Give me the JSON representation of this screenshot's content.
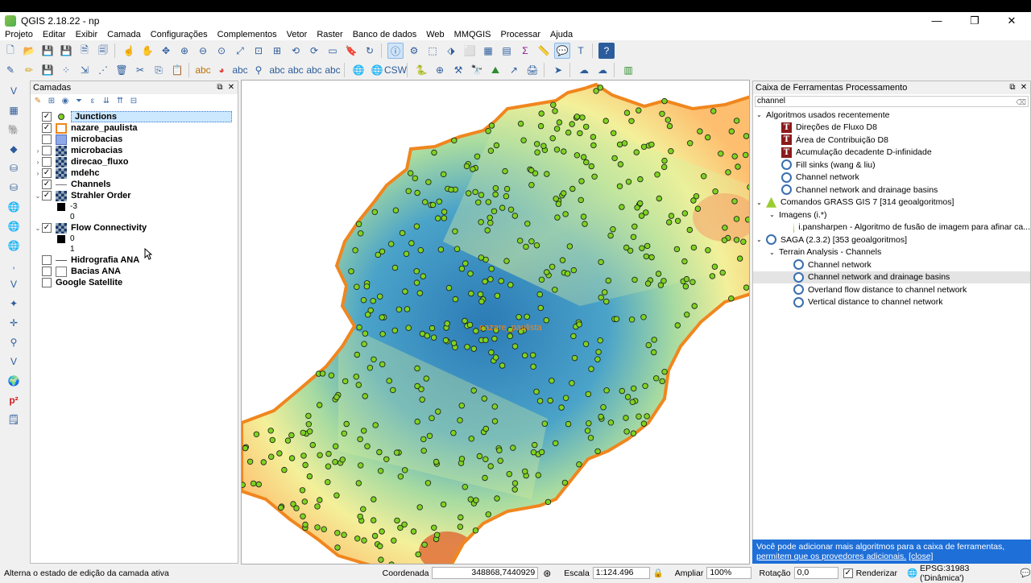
{
  "window": {
    "title": "QGIS 2.18.22 - np",
    "minimize": "—",
    "maximize": "❐",
    "close": "✕"
  },
  "menu": [
    "Projeto",
    "Editar",
    "Exibir",
    "Camada",
    "Configurações",
    "Complementos",
    "Vetor",
    "Raster",
    "Banco de dados",
    "Web",
    "MMQGIS",
    "Processar",
    "Ajuda"
  ],
  "layers_panel": {
    "title": "Camadas",
    "layers": [
      {
        "name": "Junctions",
        "checked": true,
        "expander": "",
        "icon": "point-layer-icon"
      },
      {
        "name": "nazare_paulista",
        "checked": true,
        "expander": "",
        "icon": "polygon-orange-icon"
      },
      {
        "name": "microbacias",
        "checked": false,
        "expander": "",
        "icon": "polygon-blue-icon"
      },
      {
        "name": "microbacias",
        "checked": false,
        "expander": "›",
        "icon": "raster-icon"
      },
      {
        "name": "direcao_fluxo",
        "checked": false,
        "expander": "›",
        "icon": "raster-icon"
      },
      {
        "name": "mdehc",
        "checked": true,
        "expander": "›",
        "icon": "raster-icon"
      },
      {
        "name": "Channels",
        "checked": true,
        "expander": "",
        "icon": "line-layer-icon"
      },
      {
        "name": "Strahler Order",
        "checked": true,
        "expander": "⌄",
        "icon": "raster-icon"
      }
    ],
    "strahler_legend": [
      "-3",
      "0"
    ],
    "flow_layer": {
      "name": "Flow Connectivity",
      "checked": true,
      "expander": "⌄"
    },
    "flow_legend": [
      "0",
      "1"
    ],
    "bottom_layers": [
      {
        "name": "Hidrografia ANA",
        "checked": false,
        "icon": "line-layer-icon"
      },
      {
        "name": "Bacias ANA",
        "checked": false,
        "icon": "polygon-white-icon"
      },
      {
        "name": "Google Satellite",
        "checked": false,
        "icon": ""
      }
    ]
  },
  "map": {
    "label": "nazare_paulista",
    "label_color": "#f0861e",
    "boundary_color": "#f0861e",
    "point_color": "#7ed321"
  },
  "processing": {
    "title": "Caixa de Ferramentas Processamento",
    "search_value": "channel",
    "recent_group": "Algoritmos usados recentemente",
    "recent": [
      {
        "label": "Direções de Fluxo D8",
        "icon": "taudem-icon"
      },
      {
        "label": "Área de Contribuição D8",
        "icon": "taudem-icon"
      },
      {
        "label": "Acumulação decadente D-infinidade",
        "icon": "taudem-icon"
      },
      {
        "label": "Fill sinks (wang & liu)",
        "icon": "saga-icon"
      },
      {
        "label": "Channel network",
        "icon": "saga-icon"
      },
      {
        "label": "Channel network and drainage basins",
        "icon": "saga-icon"
      }
    ],
    "grass_group": "Comandos GRASS GIS 7 [314 geoalgoritmos]",
    "grass_sub": "Imagens (i.*)",
    "grass_item": "i.pansharpen - Algoritmo de fusão de imagem para afinar ca...",
    "saga_group": "SAGA (2.3.2) [353 geoalgoritmos]",
    "saga_sub": "Terrain Analysis - Channels",
    "saga_items": [
      "Channel network",
      "Channel network and drainage basins",
      "Overland flow distance to channel network",
      "Vertical distance to channel network"
    ],
    "info_text": "Você pode adicionar mais algoritmos para a caixa de ferramentas,",
    "info_link": "permitem que os provedores adicionais.",
    "info_close": "[close]"
  },
  "status": {
    "message": "Alterna o estado de edição da camada ativa",
    "coord_label": "Coordenada",
    "coord_value": "348868,7440929",
    "scale_label": "Escala",
    "scale_value": "1:124.496",
    "zoom_label": "Ampliar",
    "zoom_value": "100%",
    "rotation_label": "Rotação",
    "rotation_value": "0,0",
    "render_label": "Renderizar",
    "crs": "EPSG:31983 ('Dinâmica')"
  }
}
